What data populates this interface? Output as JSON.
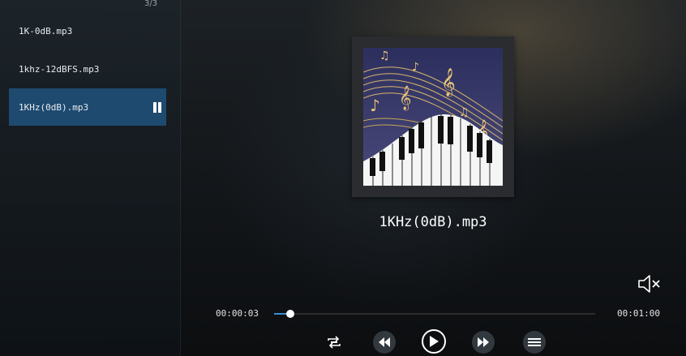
{
  "playlist": {
    "page_counter": "3/3",
    "items": [
      {
        "label": "1K-0dB.mp3",
        "active": false
      },
      {
        "label": "1khz-12dBFS.mp3",
        "active": false
      },
      {
        "label": "1KHz(0dB).mp3",
        "active": true
      }
    ]
  },
  "player": {
    "title": "1KHz(0dB).mp3",
    "elapsed": "00:00:03",
    "duration": "00:01:00",
    "progress_fraction": 0.05
  },
  "icons": {
    "mute": "speaker-muted-icon",
    "repeat": "repeat-icon",
    "previous": "rewind-icon",
    "play": "play-icon",
    "next": "fast-forward-icon",
    "playlist": "playlist-icon",
    "now_playing": "pause-icon"
  },
  "colors": {
    "active_row": "#1e4a70",
    "progress": "#3a8fd6"
  }
}
